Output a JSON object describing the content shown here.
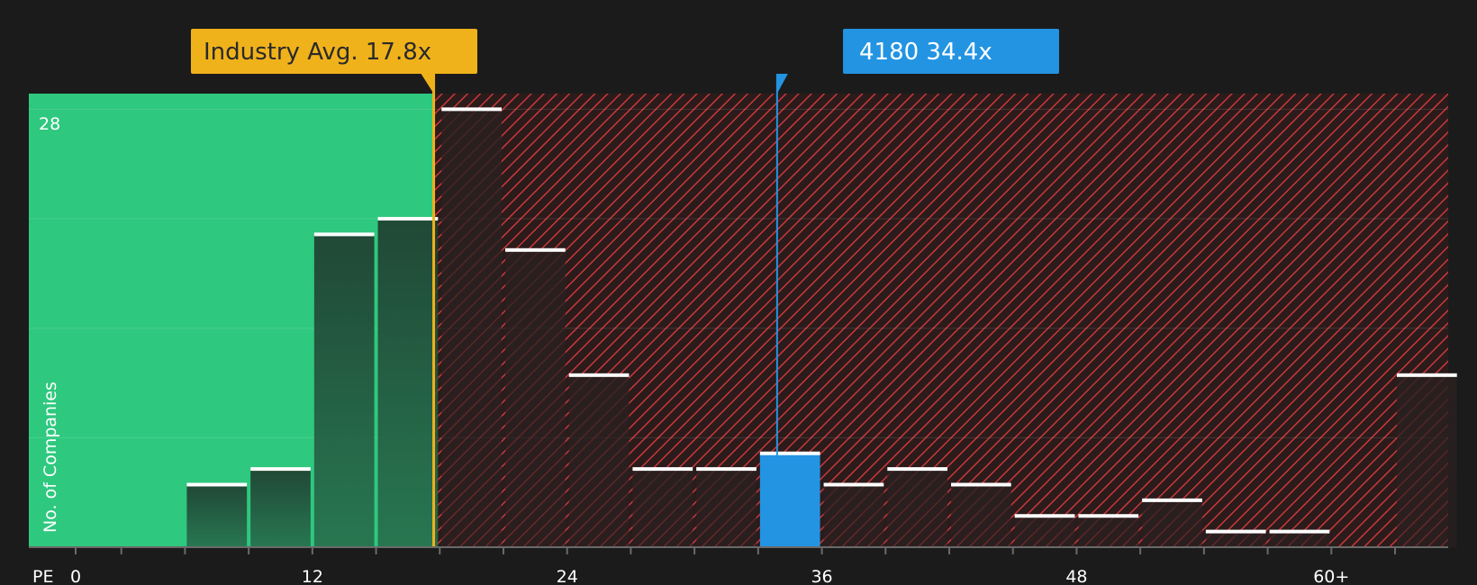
{
  "chart_data": {
    "type": "bar",
    "xlabel": "PE",
    "ylabel": "No. of Companies",
    "x_ticks": [
      "0",
      "12",
      "24",
      "36",
      "48",
      "60+"
    ],
    "y_tick_labels": [
      "28"
    ],
    "ylim": [
      0,
      29
    ],
    "bin_width": 3,
    "bars": [
      {
        "start": 0,
        "value": 0
      },
      {
        "start": 3,
        "value": 0
      },
      {
        "start": 6,
        "value": 4
      },
      {
        "start": 9,
        "value": 5
      },
      {
        "start": 12,
        "value": 20
      },
      {
        "start": 15,
        "value": 21
      },
      {
        "start": 18,
        "value": 28
      },
      {
        "start": 21,
        "value": 19
      },
      {
        "start": 24,
        "value": 11
      },
      {
        "start": 27,
        "value": 5
      },
      {
        "start": 30,
        "value": 5
      },
      {
        "start": 33,
        "value": 6
      },
      {
        "start": 36,
        "value": 4
      },
      {
        "start": 39,
        "value": 5
      },
      {
        "start": 42,
        "value": 4
      },
      {
        "start": 45,
        "value": 2
      },
      {
        "start": 48,
        "value": 2
      },
      {
        "start": 51,
        "value": 3
      },
      {
        "start": 54,
        "value": 1
      },
      {
        "start": 57,
        "value": 1
      },
      {
        "start": 60,
        "value": 0
      },
      {
        "start": 63,
        "value": 11
      }
    ],
    "industry_avg": {
      "label": "Industry Avg. 17.8x",
      "value": 17.8
    },
    "company": {
      "label": "4180 34.4x",
      "value": 34.4
    },
    "colors": {
      "background": "#1b1b1b",
      "good_zone": "#2ec87e",
      "bad_hatch": "#c8383c",
      "industry": "#f0b21b",
      "company": "#2394e2",
      "bar_dark": "#1f3a2e"
    }
  }
}
